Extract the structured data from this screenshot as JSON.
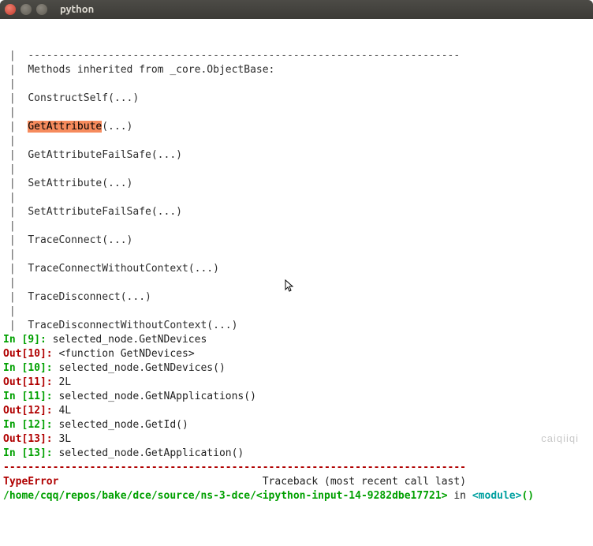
{
  "window": {
    "title": "python"
  },
  "help": {
    "sep": "----------------------------------------------------------------------",
    "heading": "Methods inherited from _core.ObjectBase:",
    "methods": [
      {
        "name": "ConstructSelf",
        "args": "(...)",
        "hl": false
      },
      {
        "name": "GetAttribute",
        "args": "(...)",
        "hl": true
      },
      {
        "name": "GetAttributeFailSafe",
        "args": "(...)",
        "hl": false
      },
      {
        "name": "SetAttribute",
        "args": "(...)",
        "hl": false
      },
      {
        "name": "SetAttributeFailSafe",
        "args": "(...)",
        "hl": false
      },
      {
        "name": "TraceConnect",
        "args": "(...)",
        "hl": false
      },
      {
        "name": "TraceConnectWithoutContext",
        "args": "(...)",
        "hl": false
      },
      {
        "name": "TraceDisconnect",
        "args": "(...)",
        "hl": false
      },
      {
        "name": "TraceDisconnectWithoutContext",
        "args": "(...)",
        "hl": false
      }
    ]
  },
  "io": [
    {
      "kind": "in",
      "num": "9",
      "text": "selected_node.GetNDevices"
    },
    {
      "kind": "out",
      "num": "10",
      "text": "<function GetNDevices>"
    },
    {
      "kind": "in",
      "num": "10",
      "text": "selected_node.GetNDevices()"
    },
    {
      "kind": "out",
      "num": "11",
      "text": "2L"
    },
    {
      "kind": "in",
      "num": "11",
      "text": "selected_node.GetNApplications()"
    },
    {
      "kind": "out",
      "num": "12",
      "text": "4L"
    },
    {
      "kind": "in",
      "num": "12",
      "text": "selected_node.GetId()"
    },
    {
      "kind": "out",
      "num": "13",
      "text": "3L"
    },
    {
      "kind": "in",
      "num": "13",
      "text": "selected_node.GetApplication()"
    }
  ],
  "error": {
    "sep": "---------------------------------------------------------------------------",
    "type": "TypeError",
    "traceback_label": "Traceback (most recent call last)",
    "path": "/home/cqq/repos/bake/dce/source/ns-3-dce/<ipython-input-14-9282dbe17721>",
    "in_word": " in ",
    "module": "<module>",
    "trail": "()"
  },
  "watermark": "caiqiiqi"
}
